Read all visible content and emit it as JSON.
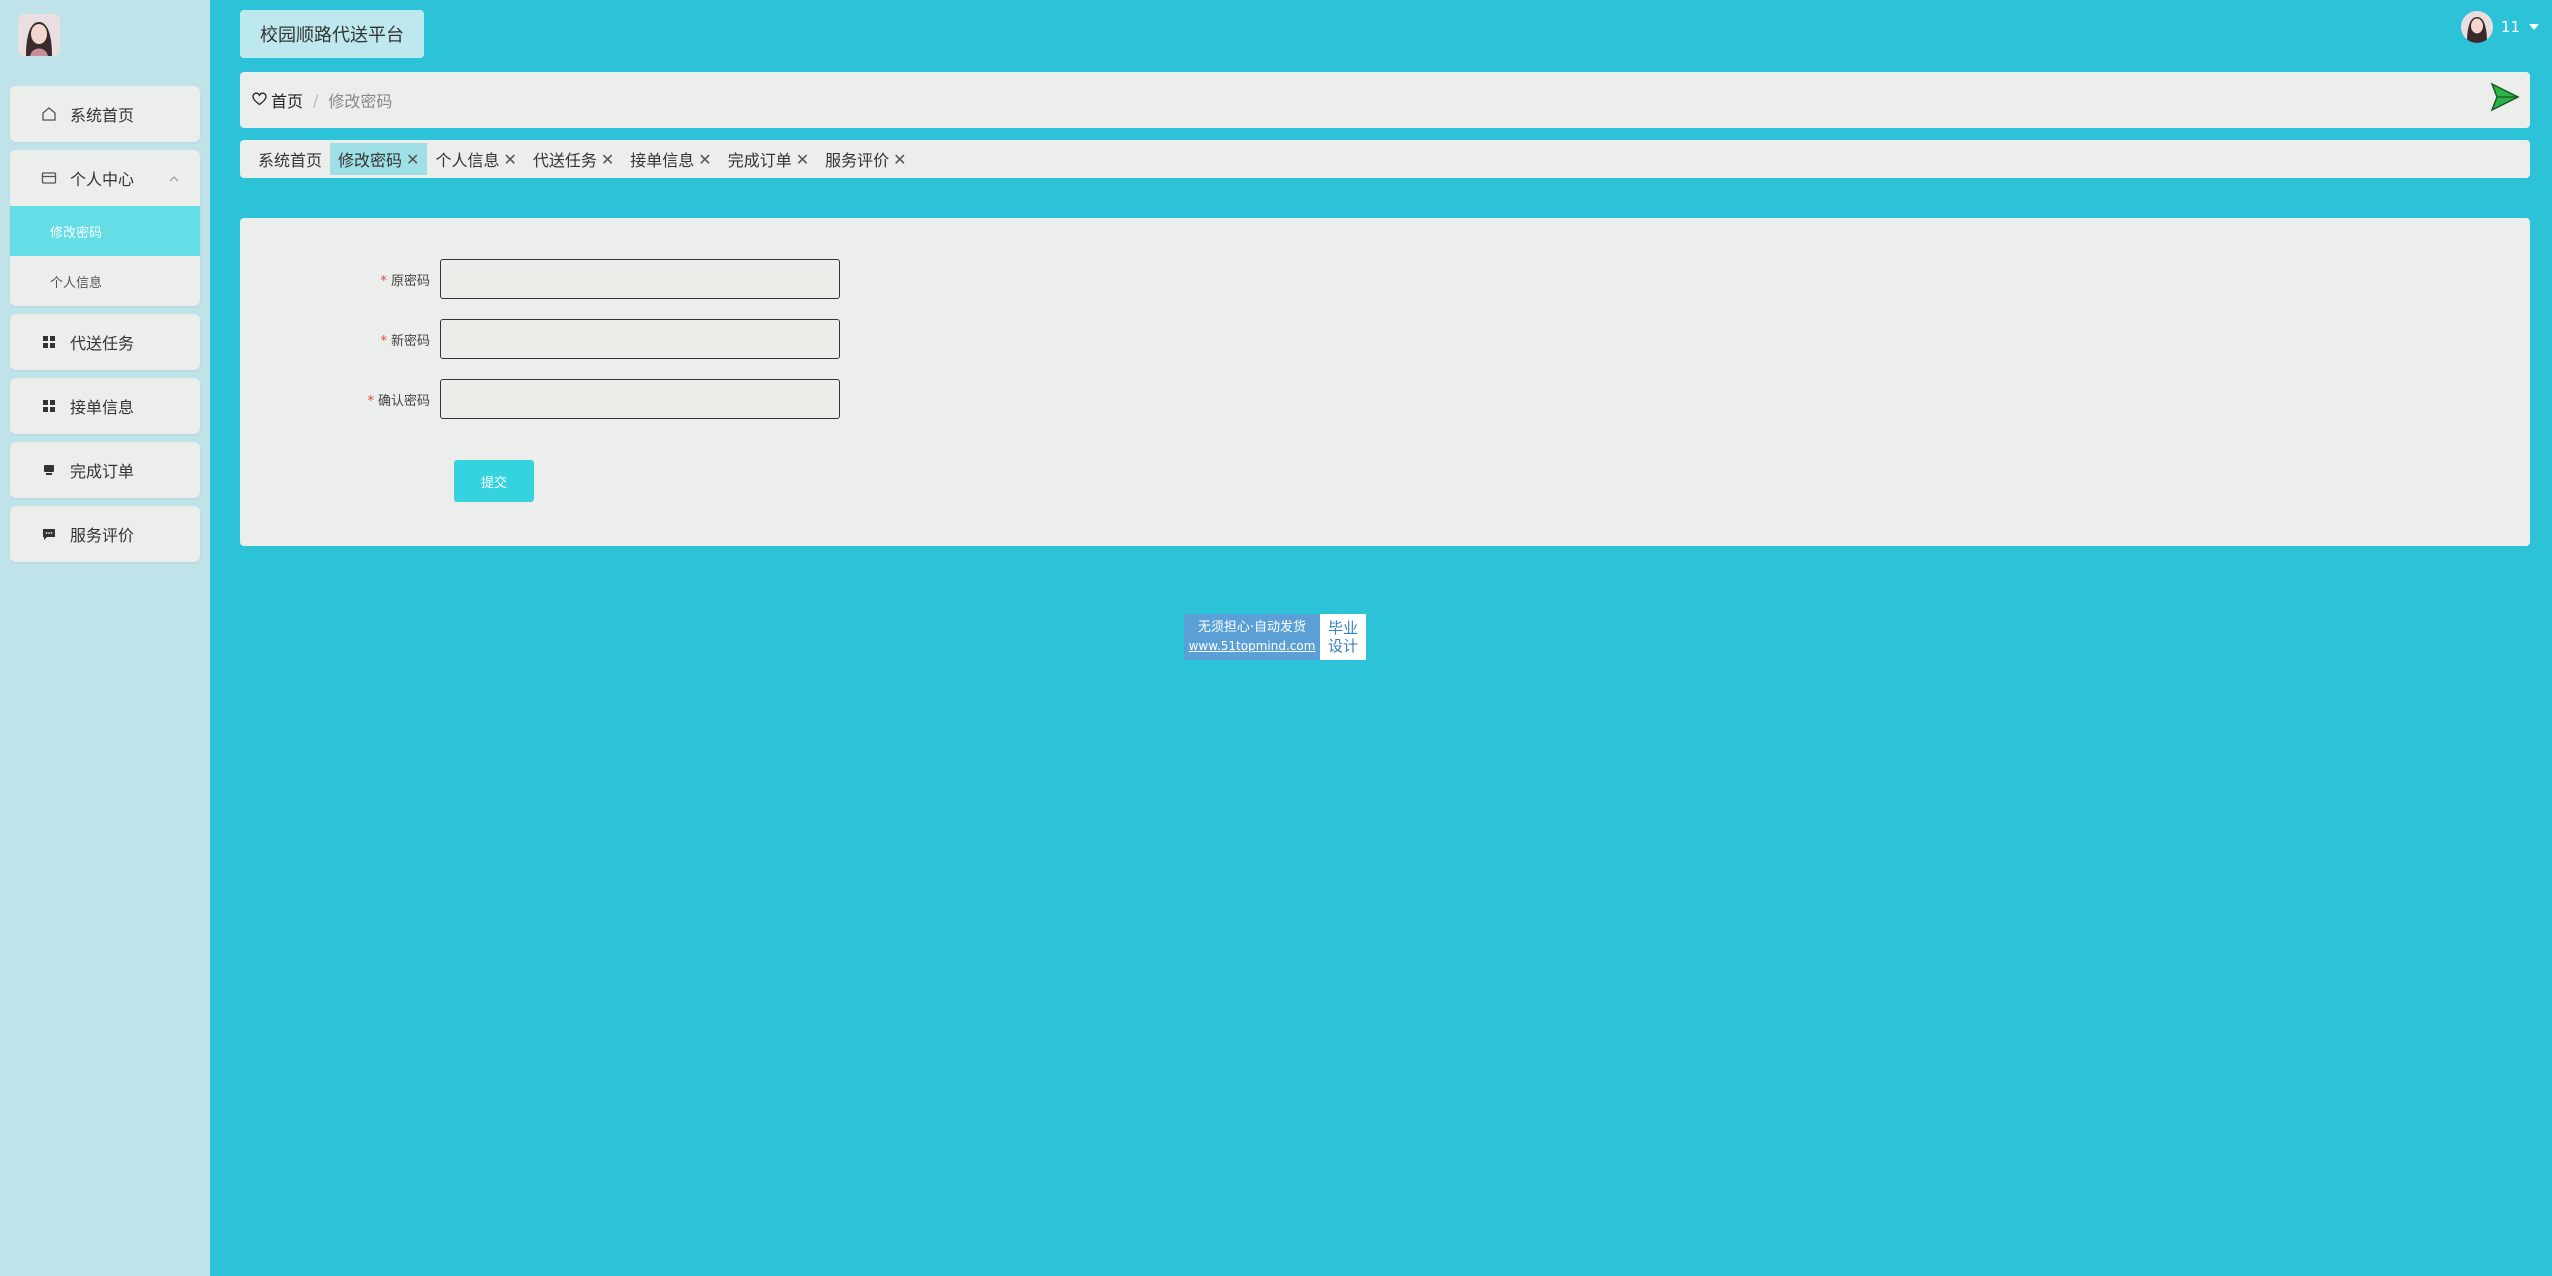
{
  "app": {
    "title": "校园顺路代送平台"
  },
  "user": {
    "name": "11"
  },
  "sidebar": {
    "items": [
      {
        "label": "系统首页",
        "icon": "home-icon"
      },
      {
        "label": "个人中心",
        "icon": "card-icon",
        "expanded": true,
        "children": [
          {
            "label": "修改密码",
            "active": true
          },
          {
            "label": "个人信息",
            "active": false
          }
        ]
      },
      {
        "label": "代送任务",
        "icon": "grid-icon"
      },
      {
        "label": "接单信息",
        "icon": "grid-icon"
      },
      {
        "label": "完成订单",
        "icon": "monitor-icon"
      },
      {
        "label": "服务评价",
        "icon": "chat-icon"
      }
    ]
  },
  "breadcrumb": {
    "home": "首页",
    "separator": "/",
    "current": "修改密码"
  },
  "tabs": [
    {
      "label": "系统首页",
      "closable": false,
      "active": false
    },
    {
      "label": "修改密码",
      "closable": true,
      "active": true
    },
    {
      "label": "个人信息",
      "closable": true,
      "active": false
    },
    {
      "label": "代送任务",
      "closable": true,
      "active": false
    },
    {
      "label": "接单信息",
      "closable": true,
      "active": false
    },
    {
      "label": "完成订单",
      "closable": true,
      "active": false
    },
    {
      "label": "服务评价",
      "closable": true,
      "active": false
    }
  ],
  "tab_close_glyph": "✕",
  "form": {
    "required_mark": "*",
    "fields": [
      {
        "label": "原密码",
        "value": ""
      },
      {
        "label": "新密码",
        "value": ""
      },
      {
        "label": "确认密码",
        "value": ""
      }
    ],
    "submit_label": "提交"
  },
  "watermark": {
    "line1": "无须担心·自动发货",
    "url": "www.51topmind.com",
    "badge_line1": "毕业",
    "badge_line2": "设计"
  },
  "colors": {
    "background": "#2cc2d8",
    "sidebar": "#bfe3e9",
    "active_sub": "#63dde6",
    "submit": "#35d3df",
    "required": "#e0463c"
  }
}
